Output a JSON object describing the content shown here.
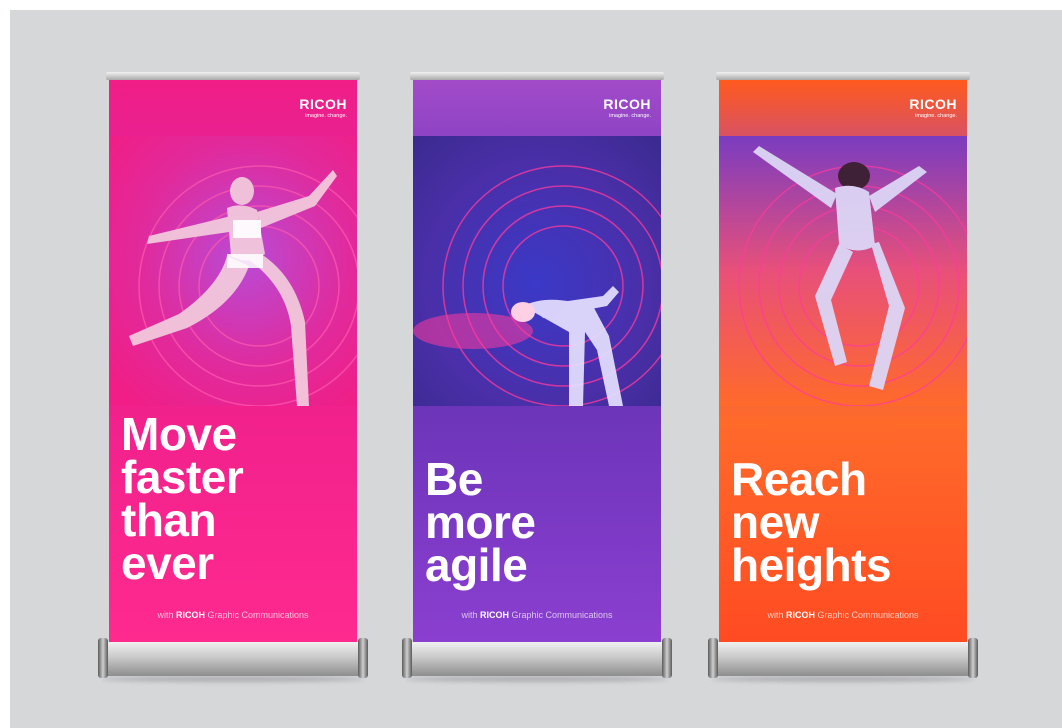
{
  "banners": [
    {
      "logo": "RICOH",
      "tagline": "imagine. change.",
      "headline": [
        "Move",
        "faster",
        "than",
        "ever"
      ],
      "footer_pre": "with",
      "footer_brand": "RICOH",
      "footer_post": "Graphic Communications",
      "bg_top": "#f01e86",
      "bg_bottom": "#ff2a8e"
    },
    {
      "logo": "RICOH",
      "tagline": "imagine. change.",
      "headline": [
        "Be",
        "more",
        "agile"
      ],
      "footer_pre": "with",
      "footer_brand": "RICOH",
      "footer_post": "Graphic Communications",
      "bg_top": "#a24bc9",
      "bg_bottom": "#8c3fd0"
    },
    {
      "logo": "RICOH",
      "tagline": "imagine. change.",
      "headline": [
        "Reach",
        "new",
        "heights"
      ],
      "footer_pre": "with",
      "footer_brand": "RICOH",
      "footer_post": "Graphic Communications",
      "bg_top": "#ff5a1e",
      "bg_bottom": "#ff4a22"
    }
  ]
}
